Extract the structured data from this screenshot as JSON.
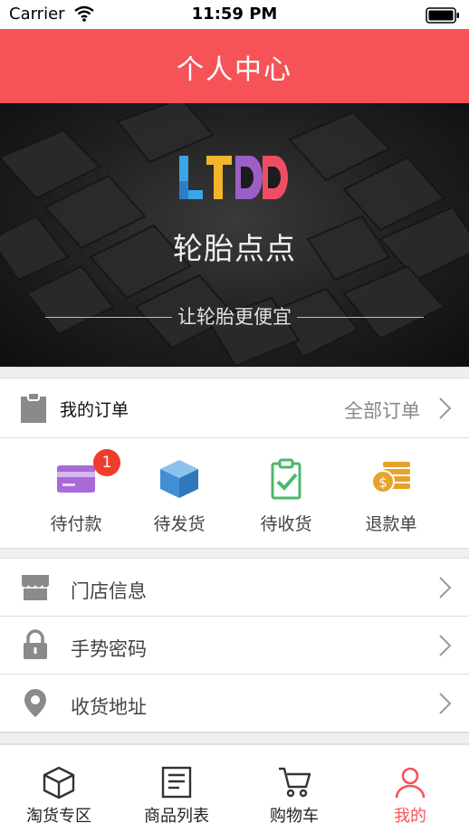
{
  "status_bar": {
    "carrier": "Carrier",
    "time": "11:59 PM"
  },
  "nav": {
    "title": "个人中心"
  },
  "banner": {
    "logo_text": "LTDD",
    "brand_name": "轮胎点点",
    "slogan": "让轮胎更便宜"
  },
  "orders": {
    "title": "我的订单",
    "view_all": "全部订单",
    "statuses": [
      {
        "label": "待付款",
        "icon": "card-icon",
        "badge": "1"
      },
      {
        "label": "待发货",
        "icon": "box-icon"
      },
      {
        "label": "待收货",
        "icon": "clipboard-check-icon"
      },
      {
        "label": "退款单",
        "icon": "coins-icon"
      }
    ]
  },
  "menu": [
    {
      "label": "门店信息",
      "icon": "store-icon"
    },
    {
      "label": "手势密码",
      "icon": "lock-icon"
    },
    {
      "label": "收货地址",
      "icon": "location-pin-icon"
    }
  ],
  "tabbar": {
    "active_index": 3,
    "items": [
      {
        "label": "淘货专区",
        "icon": "cube-icon"
      },
      {
        "label": "商品列表",
        "icon": "list-icon"
      },
      {
        "label": "购物车",
        "icon": "cart-icon"
      },
      {
        "label": "我的",
        "icon": "user-icon"
      }
    ]
  },
  "colors": {
    "primary": "#f65358",
    "badge": "#f03c2a",
    "card": "#a86ad6",
    "box": "#3f8fd4",
    "check": "#4cb86a",
    "coins": "#e8a22c"
  }
}
